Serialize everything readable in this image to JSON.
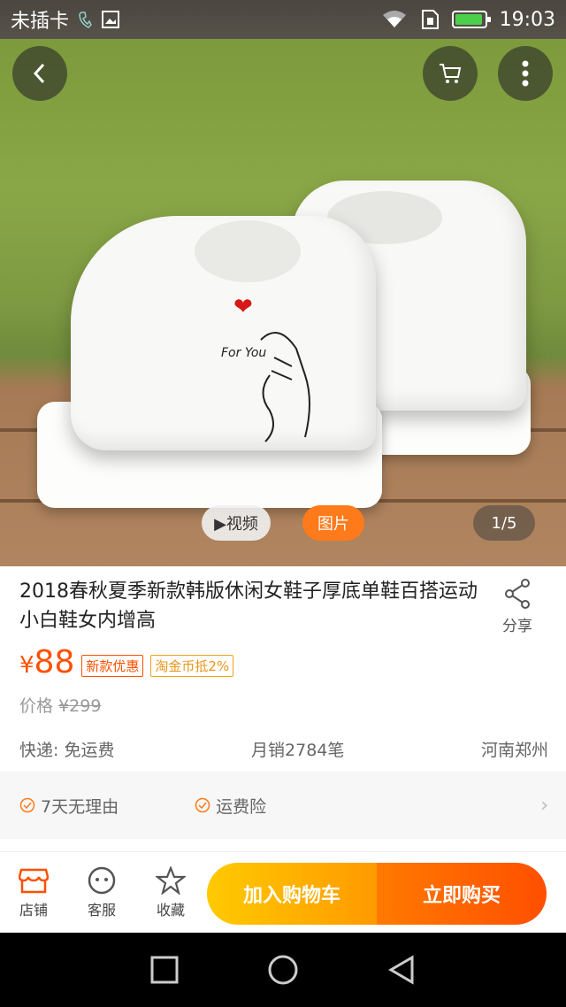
{
  "status_bar": {
    "carrier": "未插卡",
    "time": "19:03"
  },
  "gallery": {
    "video_label": "▶视频",
    "photo_label": "图片",
    "counter": "1/5",
    "shoe_print": "For You"
  },
  "product": {
    "title": "2018春秋夏季新款韩版休闲女鞋子厚底单鞋百搭运动小白鞋女内增高",
    "share_label": "分享",
    "currency": "¥",
    "price": "88",
    "tag_new": "新款优惠",
    "tag_coin": "淘金币抵2%",
    "orig_label": "价格",
    "orig_price": "¥299",
    "shipping": "快递: 免运费",
    "monthly_sales": "月销2784笔",
    "location": "河南郑州"
  },
  "services": [
    {
      "label": "7天无理由"
    },
    {
      "label": "运费险"
    }
  ],
  "action_bar": {
    "shop": "店铺",
    "service": "客服",
    "favorite": "收藏",
    "add_cart": "加入购物车",
    "buy_now": "立即购买"
  },
  "colors": {
    "accent": "#ff5000",
    "cart": "#ffb400",
    "buy": "#ff6a00"
  }
}
